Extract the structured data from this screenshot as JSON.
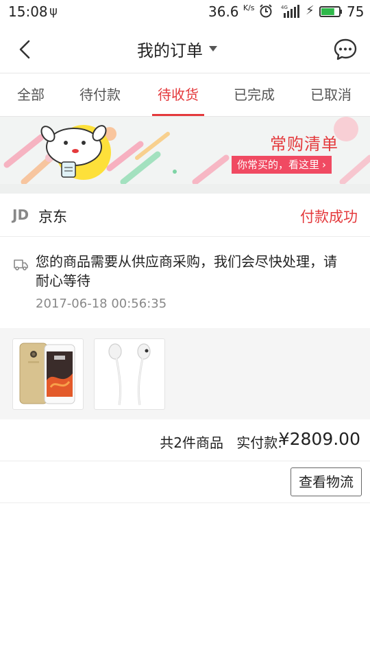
{
  "status_bar": {
    "time": "15:08",
    "speed": "36.6",
    "speed_unit": "K/s",
    "network": "4G",
    "battery": "75"
  },
  "header": {
    "title": "我的订单"
  },
  "tabs": [
    {
      "label": "全部",
      "active": false
    },
    {
      "label": "待付款",
      "active": false
    },
    {
      "label": "待收货",
      "active": true
    },
    {
      "label": "已完成",
      "active": false
    },
    {
      "label": "已取消",
      "active": false
    }
  ],
  "banner": {
    "title": "常购清单",
    "cta": "你常买的，看这里"
  },
  "order": {
    "store_logo": "JD",
    "store_name": "京东",
    "status": "付款成功",
    "tracking_message": "您的商品需要从供应商采购，我们会尽快处理，请耐心等待",
    "tracking_time": "2017-06-18 00:56:35",
    "products": [
      {
        "icon": "phone-image"
      },
      {
        "icon": "earphones-image"
      }
    ],
    "item_count_text": "共2件商品",
    "paid_label": "实付款:",
    "paid_amount": "¥2809.00",
    "logistics_button": "查看物流"
  },
  "colors": {
    "accent": "#e4393c",
    "cta_bg": "#f04a62",
    "battery_green": "#2fb84a"
  }
}
